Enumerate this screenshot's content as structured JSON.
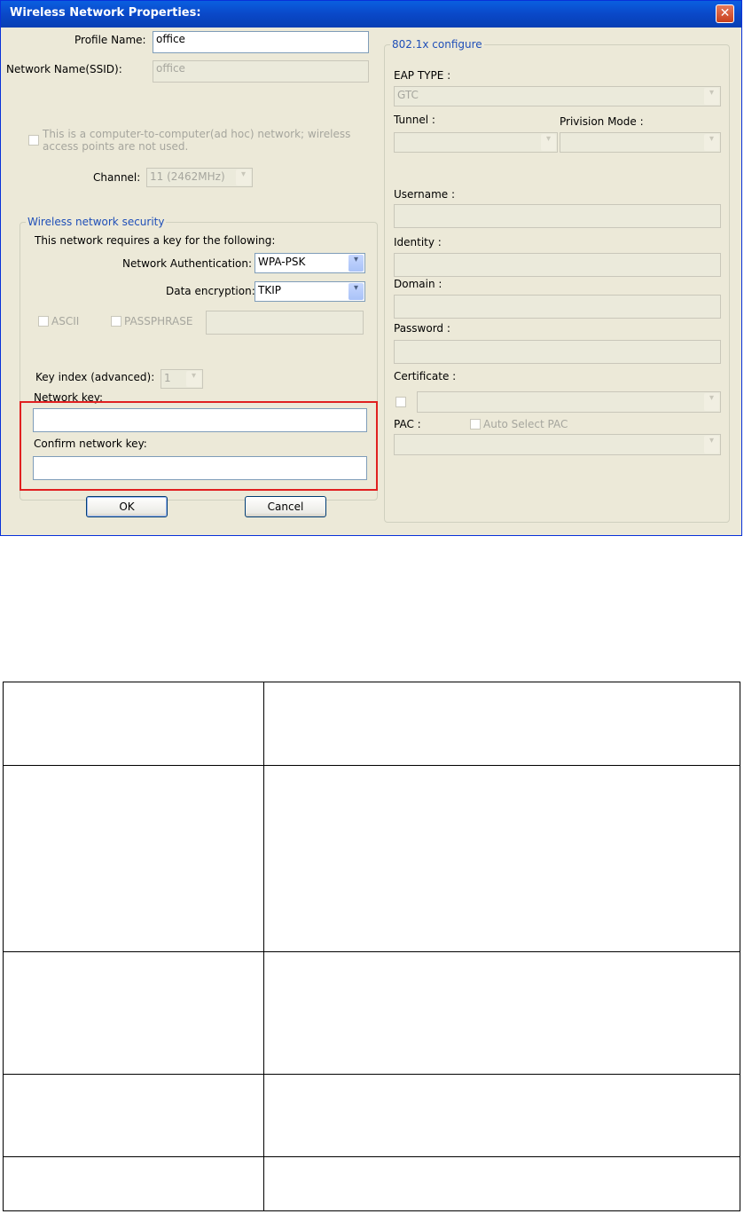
{
  "window": {
    "title": "Wireless Network Properties:",
    "close_glyph": "✕"
  },
  "left": {
    "profile_name_label": "Profile Name:",
    "profile_name_value": "office",
    "ssid_label": "Network Name(SSID):",
    "ssid_value": "office",
    "adhoc_line1": "This is a computer-to-computer(ad hoc) network; wireless",
    "adhoc_line2": "access points are not used.",
    "channel_label": "Channel:",
    "channel_value": "11 (2462MHz)",
    "security_legend": "Wireless network security",
    "requires_key_text": "This network requires a key for the following:",
    "auth_label": "Network Authentication:",
    "auth_value": "WPA-PSK",
    "encryption_label": "Data encryption:",
    "encryption_value": "TKIP",
    "ascii_label": "ASCII",
    "passphrase_label": "PASSPHRASE",
    "key_index_label": "Key index (advanced):",
    "key_index_value": "1",
    "network_key_label": "Network key:",
    "network_key_value": "",
    "confirm_key_label": "Confirm network key:",
    "confirm_key_value": "",
    "ok_label": "OK",
    "cancel_label": "Cancel"
  },
  "right": {
    "legend": "802.1x configure",
    "eap_type_label": "EAP TYPE :",
    "eap_type_value": "GTC",
    "tunnel_label": "Tunnel :",
    "provision_label": "Privision Mode :",
    "username_label": "Username :",
    "identity_label": "Identity :",
    "domain_label": "Domain :",
    "password_label": "Password :",
    "certificate_label": "Certificate :",
    "pac_label": "PAC :",
    "auto_pac_label": "Auto Select PAC"
  },
  "colors": {
    "highlight": "#e02020",
    "title_bar": "#0a48c8",
    "dialog_bg": "#ece9d8"
  },
  "icons": [
    "close-icon",
    "dropdown-arrow-icon",
    "checkbox-icon"
  ],
  "table": {
    "rows": [
      [
        "",
        ""
      ],
      [
        "",
        ""
      ],
      [
        "",
        ""
      ],
      [
        "",
        ""
      ],
      [
        "",
        ""
      ]
    ]
  }
}
